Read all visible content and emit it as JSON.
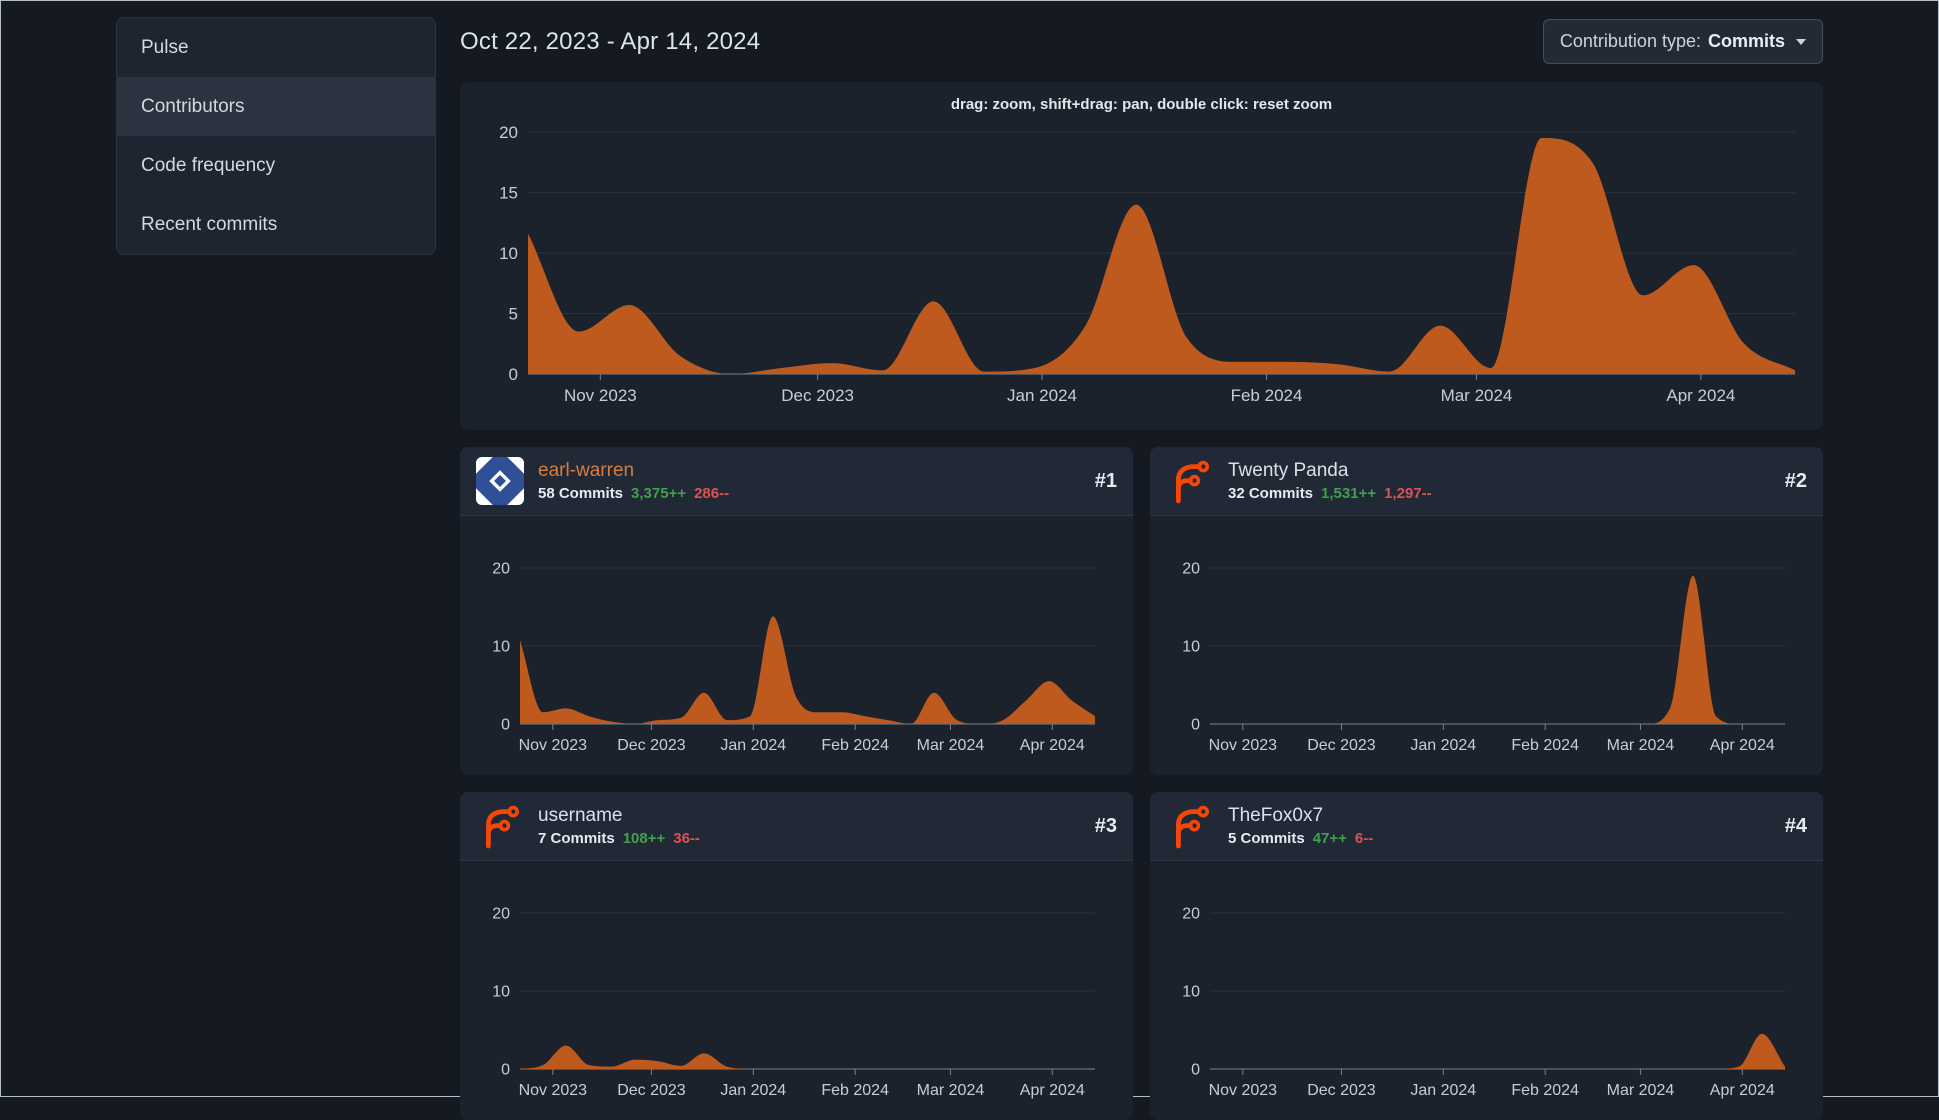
{
  "sidebar": {
    "items": [
      {
        "label": "Pulse"
      },
      {
        "label": "Contributors"
      },
      {
        "label": "Code frequency"
      },
      {
        "label": "Recent commits"
      }
    ],
    "active_item": "Contributors"
  },
  "header": {
    "date_range": "Oct 22, 2023 - Apr 14, 2024"
  },
  "controls": {
    "contribution_type_label": "Contribution type:",
    "contribution_type_value": "Commits",
    "icon": "caret-down"
  },
  "main_chart": {
    "hint": "drag: zoom, shift+drag: pan, double click: reset zoom"
  },
  "contributors": [
    {
      "rank": "#1",
      "name": "earl-warren",
      "commits": "58 Commits",
      "additions": "3,375++",
      "deletions": "286--",
      "avatar": "identicon-blue-white"
    },
    {
      "rank": "#2",
      "name": "Twenty Panda",
      "commits": "32 Commits",
      "additions": "1,531++",
      "deletions": "1,297--",
      "avatar": "forgejo-logo"
    },
    {
      "rank": "#3",
      "name": "username",
      "commits": "7 Commits",
      "additions": "108++",
      "deletions": "36--",
      "avatar": "forgejo-logo"
    },
    {
      "rank": "#4",
      "name": "TheFox0x7",
      "commits": "5 Commits",
      "additions": "47++",
      "deletions": "6--",
      "avatar": "forgejo-logo"
    }
  ],
  "colors": {
    "area_fill": "#bf5a1e",
    "additions_green": "#41a04c",
    "deletions_red": "#da5353",
    "link_orange": "#d87c3c",
    "logo_orange": "#f3470a",
    "axis_label": "#c6cdd5",
    "grid_line": "#2a313c"
  },
  "chart_data": [
    {
      "type": "area",
      "name": "all-contributions-weekly-commits",
      "x_range": "Oct 22, 2023 - Apr 14, 2024",
      "interval": "weekly",
      "color": "#bf5a1e",
      "ylim": [
        0,
        20
      ],
      "yticks": [
        0,
        5,
        10,
        15,
        20
      ],
      "tick_labels": [
        "Nov 2023",
        "Dec 2023",
        "Jan 2024",
        "Feb 2024",
        "Mar 2024",
        "Apr 2024"
      ],
      "tick_positions": [
        0.0571,
        0.2286,
        0.4057,
        0.5829,
        0.7486,
        0.9257
      ],
      "values": [
        11.6,
        3.5,
        5.7,
        1.5,
        0,
        0.5,
        0.9,
        0.3,
        6,
        0.2,
        0.5,
        4,
        14,
        3,
        1,
        1,
        0.8,
        0.2,
        4,
        0.5,
        19.5,
        17.5,
        6.5,
        9,
        2.5,
        0.3
      ]
    },
    {
      "type": "area",
      "name": "earl-warren-weekly-commits",
      "color": "#bf5a1e",
      "ylim": [
        0,
        20
      ],
      "yticks": [
        0,
        10,
        20
      ],
      "tick_labels": [
        "Nov 2023",
        "Dec 2023",
        "Jan 2024",
        "Feb 2024",
        "Mar 2024",
        "Apr 2024"
      ],
      "tick_positions": [
        0.0571,
        0.2286,
        0.4057,
        0.5829,
        0.7486,
        0.9257
      ],
      "values": [
        10.7,
        1.5,
        2,
        1,
        0.3,
        0,
        0.5,
        0.8,
        4,
        0.5,
        1,
        13.8,
        3.5,
        1.5,
        1.5,
        1,
        0.5,
        0,
        4,
        0.5,
        0,
        0.5,
        3,
        5.5,
        3,
        1
      ]
    },
    {
      "type": "area",
      "name": "twenty-panda-weekly-commits",
      "color": "#bf5a1e",
      "ylim": [
        0,
        20
      ],
      "yticks": [
        0,
        10,
        20
      ],
      "tick_labels": [
        "Nov 2023",
        "Dec 2023",
        "Jan 2024",
        "Feb 2024",
        "Mar 2024",
        "Apr 2024"
      ],
      "tick_positions": [
        0.0571,
        0.2286,
        0.4057,
        0.5829,
        0.7486,
        0.9257
      ],
      "values": [
        0,
        0,
        0,
        0,
        0,
        0,
        0,
        0,
        0,
        0,
        0,
        0,
        0,
        0,
        0,
        0,
        0,
        0,
        0,
        0,
        2,
        19,
        1,
        0,
        0,
        0
      ]
    },
    {
      "type": "area",
      "name": "username-weekly-commits",
      "color": "#bf5a1e",
      "ylim": [
        0,
        20
      ],
      "yticks": [
        0,
        10,
        20
      ],
      "tick_labels": [
        "Nov 2023",
        "Dec 2023",
        "Jan 2024",
        "Feb 2024",
        "Mar 2024",
        "Apr 2024"
      ],
      "tick_positions": [
        0.0571,
        0.2286,
        0.4057,
        0.5829,
        0.7486,
        0.9257
      ],
      "values": [
        0,
        0.5,
        3,
        0.5,
        0.3,
        1.2,
        1,
        0.4,
        2,
        0.3,
        0,
        0,
        0,
        0,
        0,
        0,
        0,
        0,
        0,
        0,
        0,
        0,
        0,
        0,
        0,
        0
      ]
    },
    {
      "type": "area",
      "name": "thefox0x7-weekly-commits",
      "color": "#bf5a1e",
      "ylim": [
        0,
        20
      ],
      "yticks": [
        0,
        10,
        20
      ],
      "tick_labels": [
        "Nov 2023",
        "Dec 2023",
        "Jan 2024",
        "Feb 2024",
        "Mar 2024",
        "Apr 2024"
      ],
      "tick_positions": [
        0.0571,
        0.2286,
        0.4057,
        0.5829,
        0.7486,
        0.9257
      ],
      "values": [
        0,
        0,
        0,
        0,
        0,
        0,
        0,
        0,
        0,
        0,
        0,
        0,
        0,
        0,
        0,
        0,
        0,
        0,
        0,
        0,
        0,
        0,
        0,
        0.3,
        4.5,
        0.3
      ]
    }
  ]
}
